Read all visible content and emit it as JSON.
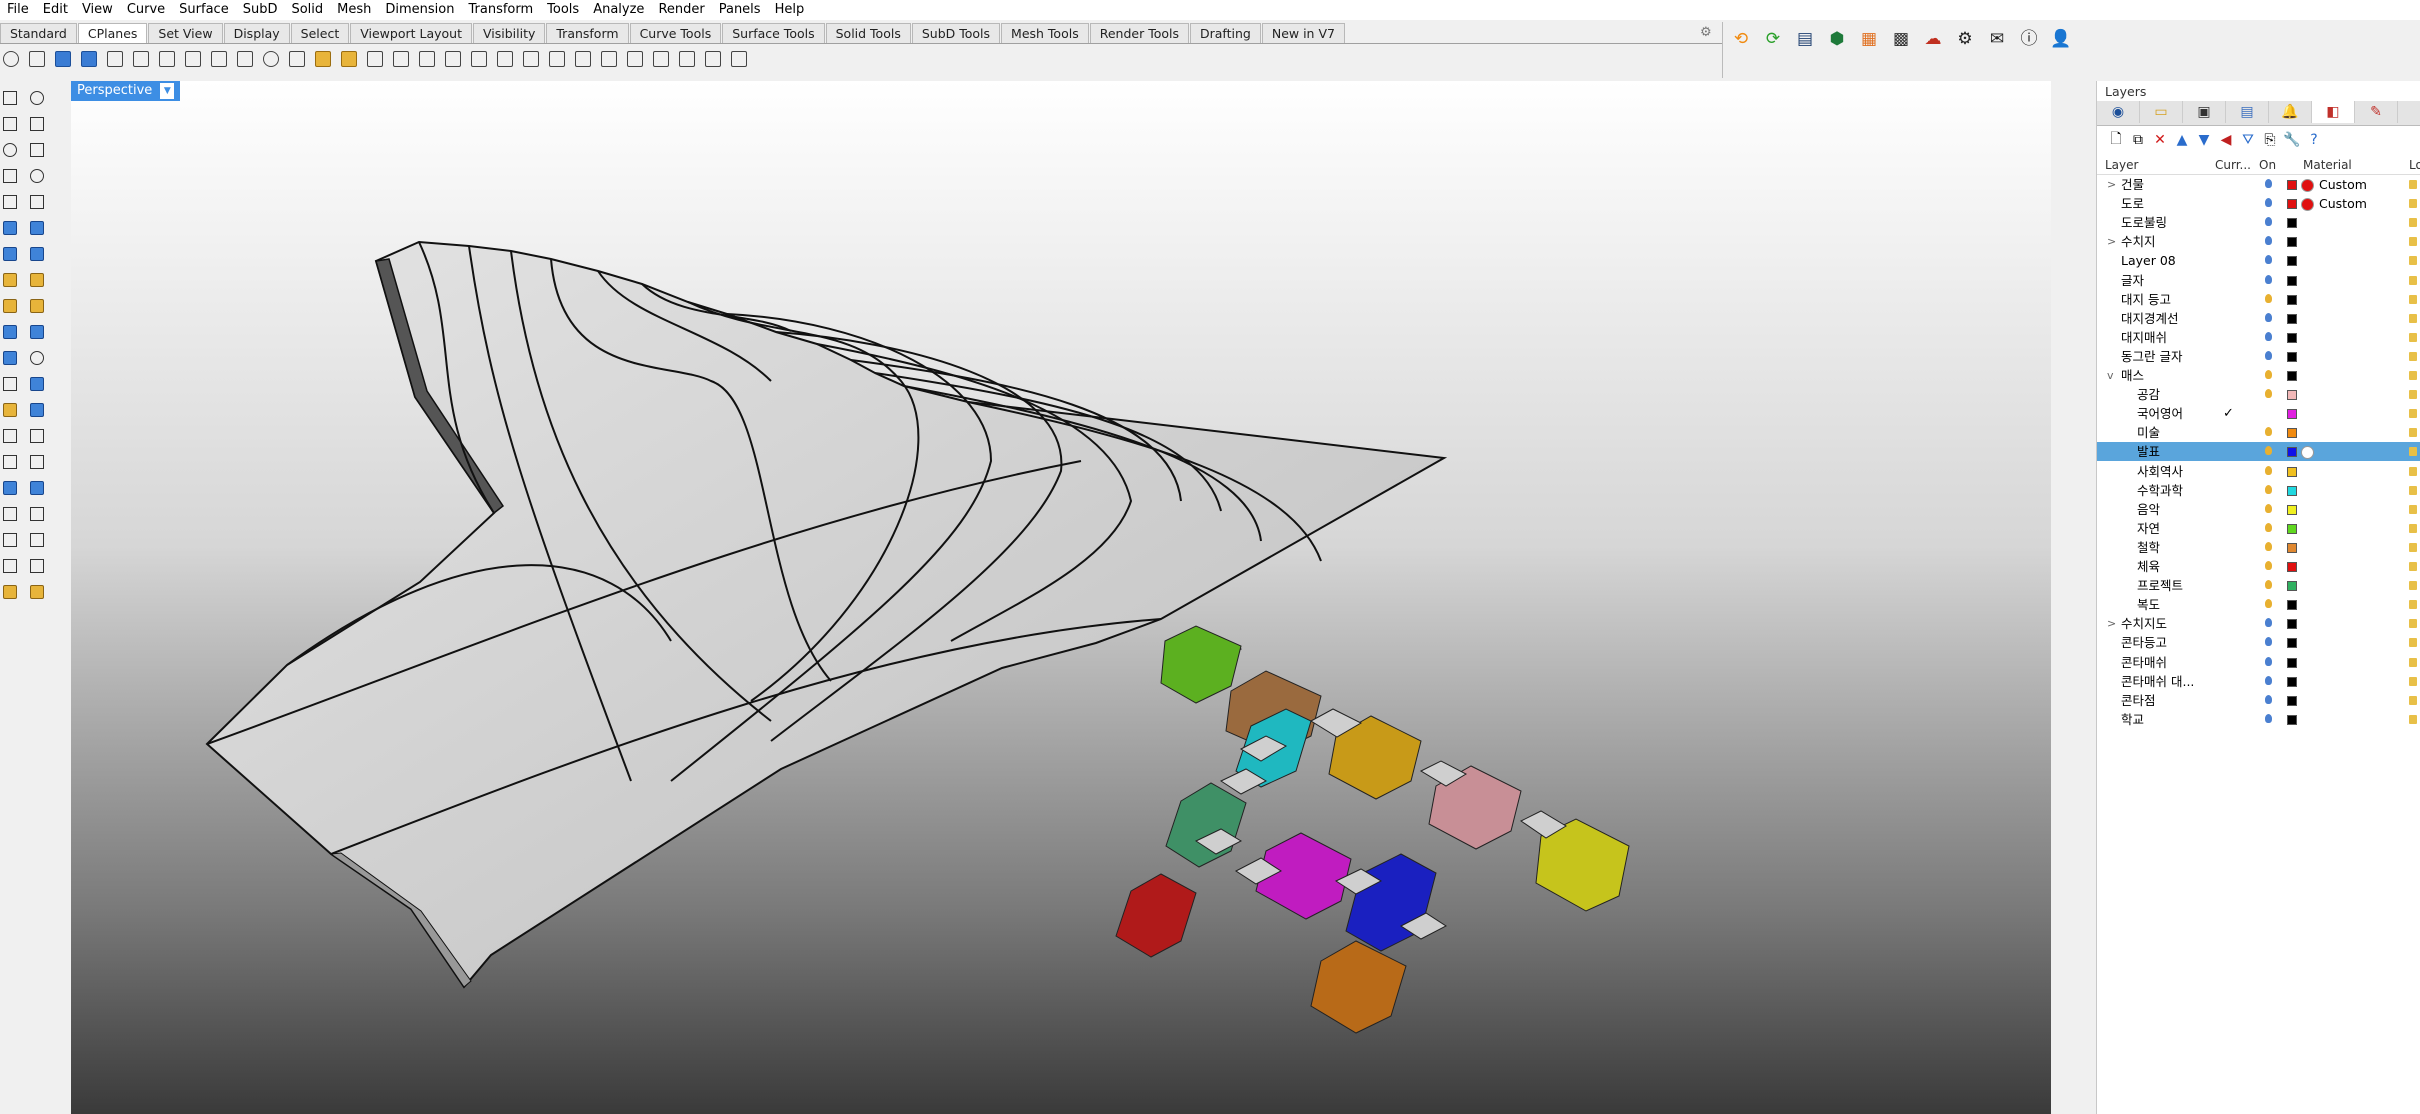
{
  "menu": [
    "File",
    "Edit",
    "View",
    "Curve",
    "Surface",
    "SubD",
    "Solid",
    "Mesh",
    "Dimension",
    "Transform",
    "Tools",
    "Analyze",
    "Render",
    "Panels",
    "Help"
  ],
  "toolbar_tabs": [
    "Standard",
    "CPlanes",
    "Set View",
    "Display",
    "Select",
    "Viewport Layout",
    "Visibility",
    "Transform",
    "Curve Tools",
    "Surface Tools",
    "Solid Tools",
    "SubD Tools",
    "Mesh Tools",
    "Render Tools",
    "Drafting",
    "New in V7"
  ],
  "active_tab": "CPlanes",
  "viewport": {
    "label": "Perspective"
  },
  "layers_panel": {
    "title": "Layers",
    "columns": {
      "layer": "Layer",
      "current": "Curr...",
      "on": "On",
      "material": "Material",
      "lock": "Lo"
    },
    "rows": [
      {
        "name": "건물",
        "expander": ">",
        "indent": 0,
        "current": "",
        "on": "blue",
        "color": "#e01010",
        "material_color": "#e01010",
        "material": "Custom",
        "selected": false
      },
      {
        "name": "도로",
        "expander": "",
        "indent": 0,
        "current": "",
        "on": "blue",
        "color": "#e01010",
        "material_color": "#e01010",
        "material": "Custom",
        "selected": false
      },
      {
        "name": "도로불링",
        "expander": "",
        "indent": 0,
        "current": "",
        "on": "blue",
        "color": "#000000",
        "material_color": "",
        "material": "",
        "selected": false
      },
      {
        "name": "수치지",
        "expander": ">",
        "indent": 0,
        "current": "",
        "on": "blue",
        "color": "#000000",
        "material_color": "",
        "material": "",
        "selected": false
      },
      {
        "name": "Layer 08",
        "expander": "",
        "indent": 0,
        "current": "",
        "on": "blue",
        "color": "#000000",
        "material_color": "",
        "material": "",
        "selected": false
      },
      {
        "name": "글자",
        "expander": "",
        "indent": 0,
        "current": "",
        "on": "blue",
        "color": "#000000",
        "material_color": "",
        "material": "",
        "selected": false
      },
      {
        "name": "대지 등고",
        "expander": "",
        "indent": 0,
        "current": "",
        "on": "yellow",
        "color": "#000000",
        "material_color": "",
        "material": "",
        "selected": false
      },
      {
        "name": "대지경계선",
        "expander": "",
        "indent": 0,
        "current": "",
        "on": "blue",
        "color": "#000000",
        "material_color": "",
        "material": "",
        "selected": false
      },
      {
        "name": "대지매쉬",
        "expander": "",
        "indent": 0,
        "current": "",
        "on": "blue",
        "color": "#000000",
        "material_color": "",
        "material": "",
        "selected": false
      },
      {
        "name": "동그란 글자",
        "expander": "",
        "indent": 0,
        "current": "",
        "on": "blue",
        "color": "#000000",
        "material_color": "",
        "material": "",
        "selected": false
      },
      {
        "name": "매스",
        "expander": "v",
        "indent": 0,
        "current": "",
        "on": "yellow",
        "color": "#000000",
        "material_color": "",
        "material": "",
        "selected": false
      },
      {
        "name": "공감",
        "expander": "",
        "indent": 1,
        "current": "",
        "on": "yellow",
        "color": "#f2b8b8",
        "material_color": "",
        "material": "",
        "selected": false
      },
      {
        "name": "국어영어",
        "expander": "",
        "indent": 1,
        "current": "✓",
        "on": "",
        "color": "#e020e0",
        "material_color": "",
        "material": "",
        "selected": false
      },
      {
        "name": "미술",
        "expander": "",
        "indent": 1,
        "current": "",
        "on": "yellow",
        "color": "#f08a10",
        "material_color": "",
        "material": "",
        "selected": false
      },
      {
        "name": "발표",
        "expander": "",
        "indent": 1,
        "current": "",
        "on": "yellow",
        "color": "#1010e8",
        "material_color": "#ffffff",
        "material": "",
        "selected": true
      },
      {
        "name": "사회역사",
        "expander": "",
        "indent": 1,
        "current": "",
        "on": "yellow",
        "color": "#f0c020",
        "material_color": "",
        "material": "",
        "selected": false
      },
      {
        "name": "수학과학",
        "expander": "",
        "indent": 1,
        "current": "",
        "on": "yellow",
        "color": "#20d8e0",
        "material_color": "",
        "material": "",
        "selected": false
      },
      {
        "name": "음악",
        "expander": "",
        "indent": 1,
        "current": "",
        "on": "yellow",
        "color": "#f0f020",
        "material_color": "",
        "material": "",
        "selected": false
      },
      {
        "name": "자연",
        "expander": "",
        "indent": 1,
        "current": "",
        "on": "yellow",
        "color": "#60d820",
        "material_color": "",
        "material": "",
        "selected": false
      },
      {
        "name": "철학",
        "expander": "",
        "indent": 1,
        "current": "",
        "on": "yellow",
        "color": "#e08830",
        "material_color": "",
        "material": "",
        "selected": false
      },
      {
        "name": "체육",
        "expander": "",
        "indent": 1,
        "current": "",
        "on": "yellow",
        "color": "#e01010",
        "material_color": "",
        "material": "",
        "selected": false
      },
      {
        "name": "프로젝트",
        "expander": "",
        "indent": 1,
        "current": "",
        "on": "yellow",
        "color": "#30b060",
        "material_color": "",
        "material": "",
        "selected": false
      },
      {
        "name": "복도",
        "expander": "",
        "indent": 1,
        "current": "",
        "on": "yellow",
        "color": "#000000",
        "material_color": "",
        "material": "",
        "selected": false
      },
      {
        "name": "수치지도",
        "expander": ">",
        "indent": 0,
        "current": "",
        "on": "blue",
        "color": "#000000",
        "material_color": "",
        "material": "",
        "selected": false
      },
      {
        "name": "콘타등고",
        "expander": "",
        "indent": 0,
        "current": "",
        "on": "blue",
        "color": "#000000",
        "material_color": "",
        "material": "",
        "selected": false
      },
      {
        "name": "콘타매쉬",
        "expander": "",
        "indent": 0,
        "current": "",
        "on": "blue",
        "color": "#000000",
        "material_color": "",
        "material": "",
        "selected": false
      },
      {
        "name": "콘타매쉬 대...",
        "expander": "",
        "indent": 0,
        "current": "",
        "on": "blue",
        "color": "#000000",
        "material_color": "",
        "material": "",
        "selected": false
      },
      {
        "name": "콘타점",
        "expander": "",
        "indent": 0,
        "current": "",
        "on": "blue",
        "color": "#000000",
        "material_color": "",
        "material": "",
        "selected": false
      },
      {
        "name": "학교",
        "expander": "",
        "indent": 0,
        "current": "",
        "on": "blue",
        "color": "#000000",
        "material_color": "",
        "material": "",
        "selected": false
      }
    ]
  },
  "colors": {
    "accent": "#3d8ee4",
    "selected_row": "#5aa5dc",
    "bulb_on_blue": "#4a7fd0",
    "bulb_on_yellow": "#e8b030"
  }
}
